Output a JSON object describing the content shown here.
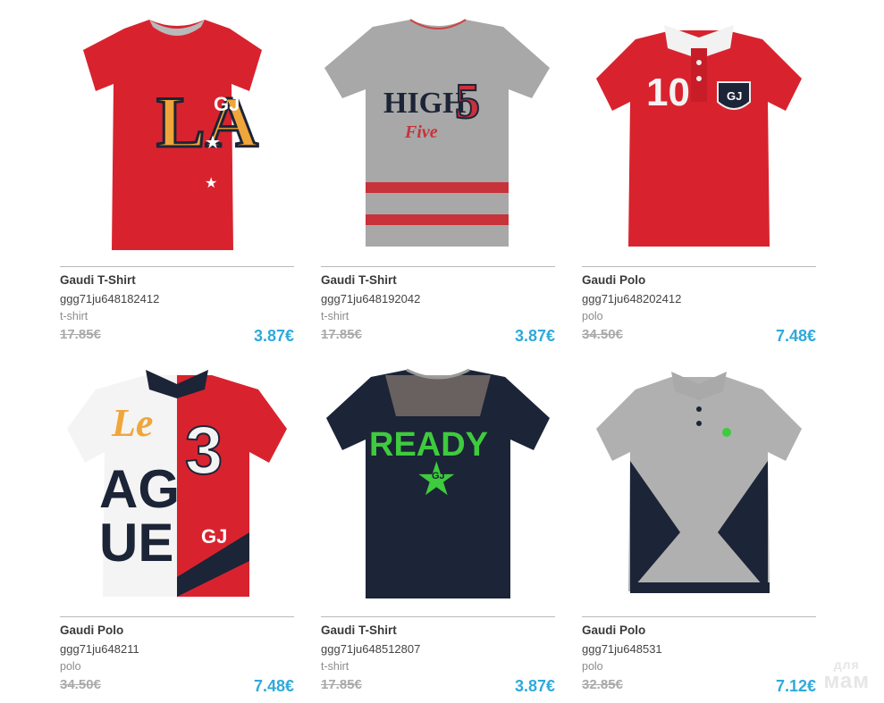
{
  "products": [
    {
      "name": "Gaudi T-Shirt",
      "sku": "ggg71ju648182412",
      "category": "t-shirt",
      "old_price": "17.85€",
      "new_price": "3.87€",
      "image": "red-la-tshirt",
      "print": [
        "LA",
        "GJ"
      ]
    },
    {
      "name": "Gaudi T-Shirt",
      "sku": "ggg71ju648192042",
      "category": "t-shirt",
      "old_price": "17.85€",
      "new_price": "3.87€",
      "image": "grey-high-five-tshirt",
      "print": [
        "HIGH",
        "5",
        "Five"
      ]
    },
    {
      "name": "Gaudi Polo",
      "sku": "ggg71ju648202412",
      "category": "polo",
      "old_price": "34.50€",
      "new_price": "7.48€",
      "image": "red-10-polo",
      "print": [
        "10",
        "GJ"
      ]
    },
    {
      "name": "Gaudi Polo",
      "sku": "ggg71ju648211",
      "category": "polo",
      "old_price": "34.50€",
      "new_price": "7.48€",
      "image": "white-red-league-polo",
      "print": [
        "Le",
        "AG",
        "UE",
        "3",
        "GJ"
      ]
    },
    {
      "name": "Gaudi T-Shirt",
      "sku": "ggg71ju648512807",
      "category": "t-shirt",
      "old_price": "17.85€",
      "new_price": "3.87€",
      "image": "navy-ready-tshirt",
      "print": [
        "READY",
        "GJ"
      ]
    },
    {
      "name": "Gaudi Polo",
      "sku": "ggg71ju648531",
      "category": "polo",
      "old_price": "32.85€",
      "new_price": "7.12€",
      "image": "grey-navy-polo",
      "print": []
    }
  ],
  "watermark": {
    "line1": "для",
    "line2": "мам"
  },
  "colors": {
    "price": "#2fa9dc",
    "old_price": "#a9a9a9",
    "red": "#d9202c",
    "navy": "#1c2437",
    "grey": "#a9a9a9",
    "green": "#3ecb3e"
  }
}
